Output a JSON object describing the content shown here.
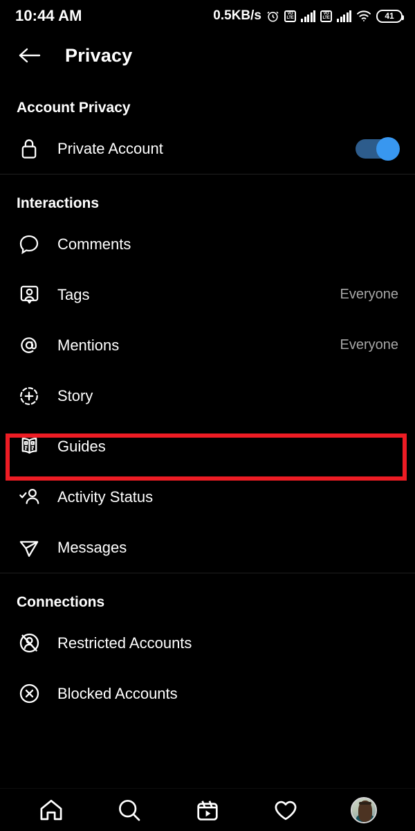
{
  "statusbar": {
    "time": "10:44 AM",
    "network_speed": "0.5KB/s",
    "alarm_icon": "alarm-clock-icon",
    "sim1": {
      "volte_top": "VO",
      "volte_bottom": "LTE"
    },
    "sim2": {
      "volte_top": "VO",
      "volte_bottom": "LTE"
    },
    "wifi_icon": "wifi-icon",
    "battery_level": "41"
  },
  "header": {
    "back_icon": "back-arrow-icon",
    "title": "Privacy"
  },
  "sections": [
    {
      "title": "Account Privacy",
      "rows": [
        {
          "label": "Private Account",
          "icon": "lock-icon",
          "control": "toggle",
          "toggle_on": true,
          "value": ""
        }
      ]
    },
    {
      "title": "Interactions",
      "rows": [
        {
          "label": "Comments",
          "icon": "comment-bubble-icon",
          "value": ""
        },
        {
          "label": "Tags",
          "icon": "tags-person-icon",
          "value": "Everyone"
        },
        {
          "label": "Mentions",
          "icon": "at-mention-icon",
          "value": "Everyone"
        },
        {
          "label": "Story",
          "icon": "story-plus-icon",
          "value": "",
          "highlighted": true
        },
        {
          "label": "Guides",
          "icon": "guides-book-icon",
          "value": ""
        },
        {
          "label": "Activity Status",
          "icon": "activity-status-icon",
          "value": ""
        },
        {
          "label": "Messages",
          "icon": "messages-paper-plane-icon",
          "value": ""
        }
      ]
    },
    {
      "title": "Connections",
      "rows": [
        {
          "label": "Restricted Accounts",
          "icon": "restricted-accounts-icon",
          "value": ""
        },
        {
          "label": "Blocked Accounts",
          "icon": "blocked-accounts-icon",
          "value": ""
        }
      ]
    }
  ],
  "bottom_nav": [
    {
      "name": "home-icon"
    },
    {
      "name": "search-icon"
    },
    {
      "name": "reels-icon"
    },
    {
      "name": "heart-icon"
    },
    {
      "name": "profile-avatar"
    }
  ],
  "colors": {
    "background": "#000000",
    "text_primary": "#ffffff",
    "text_secondary": "#a8a8a8",
    "accent_toggle": "#3897f0",
    "toggle_track": "#2d5c8c",
    "highlight": "#ed1c24",
    "divider": "#1f1f1f"
  }
}
